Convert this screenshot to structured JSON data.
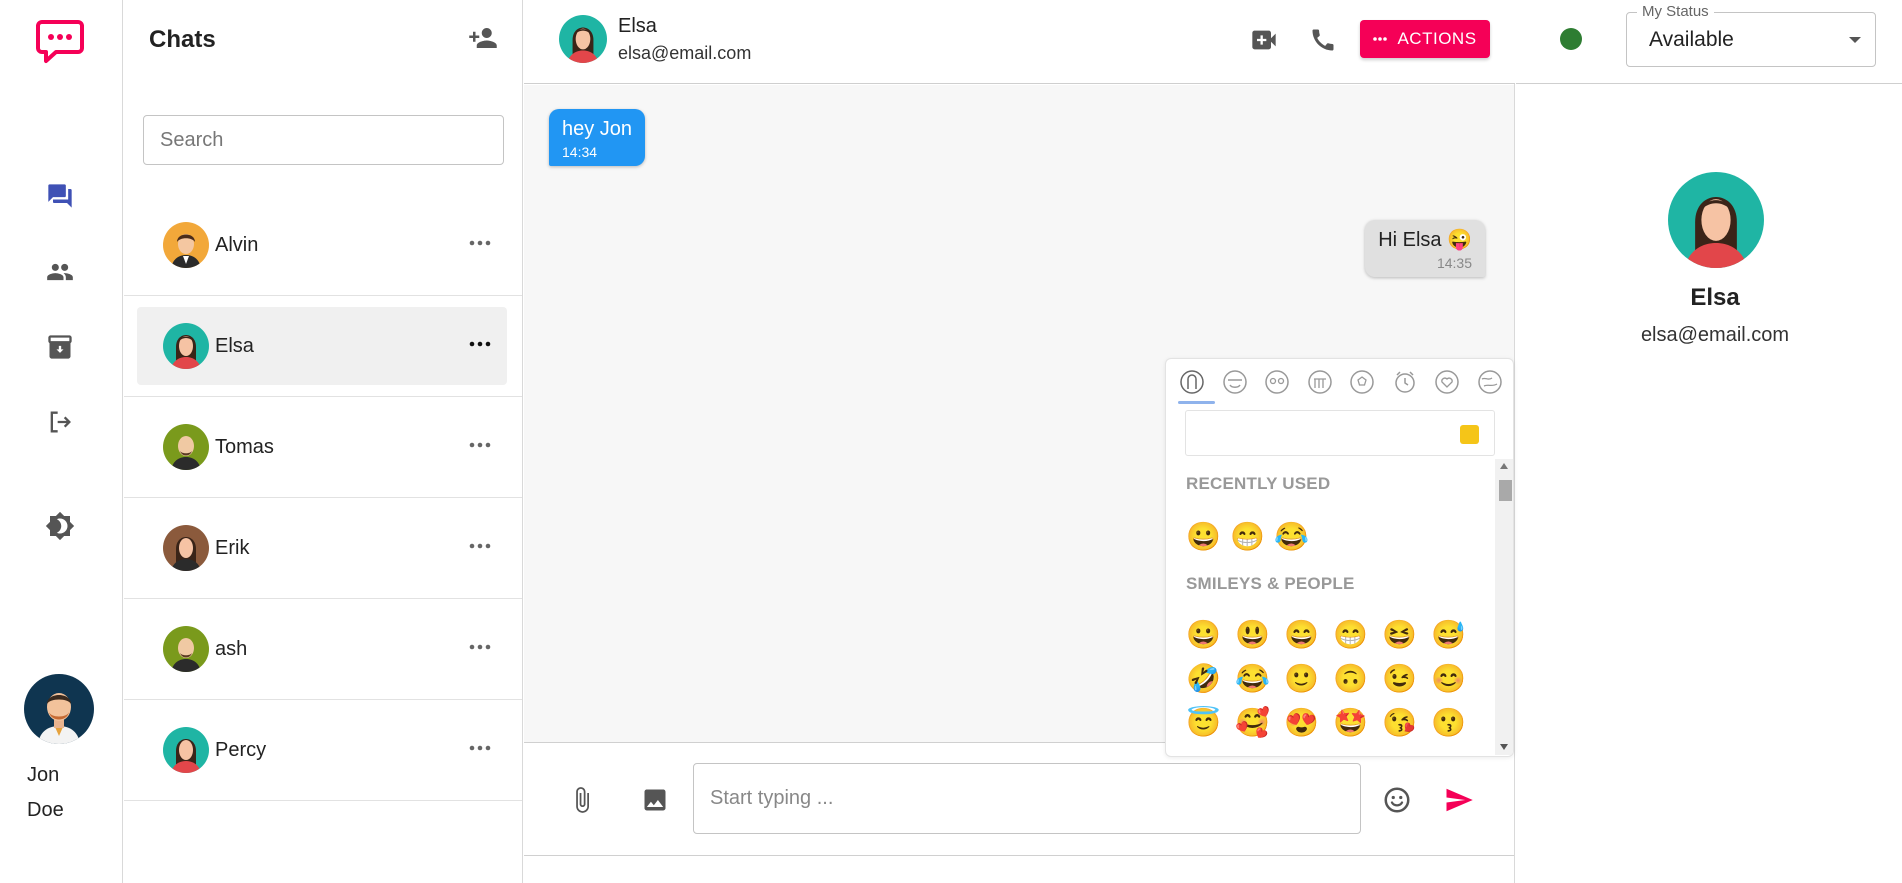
{
  "brand": {
    "accent": "#f50057",
    "primary": "#3f51b5",
    "incoming_bubble": "#2196f3"
  },
  "nav": {
    "items": [
      {
        "name": "chats-icon"
      },
      {
        "name": "contacts-icon"
      },
      {
        "name": "archive-icon"
      },
      {
        "name": "logout-icon"
      },
      {
        "name": "theme-toggle-icon"
      }
    ],
    "user": {
      "first": "Jon",
      "last": "Doe"
    }
  },
  "chats": {
    "title": "Chats",
    "search_placeholder": "Search",
    "contacts": [
      {
        "name": "Alvin",
        "avatar": "man-orange"
      },
      {
        "name": "Elsa",
        "avatar": "woman-teal",
        "active": true
      },
      {
        "name": "Tomas",
        "avatar": "man-green"
      },
      {
        "name": "Erik",
        "avatar": "woman-brown"
      },
      {
        "name": "ash",
        "avatar": "man-green"
      },
      {
        "name": "Percy",
        "avatar": "woman-teal"
      }
    ]
  },
  "conversation": {
    "contact_name": "Elsa",
    "contact_email": "elsa@email.com",
    "actions_label": "ACTIONS",
    "messages": [
      {
        "text": "hey Jon",
        "time": "14:34",
        "direction": "in"
      },
      {
        "text": "Hi Elsa 😜",
        "time": "14:35",
        "direction": "out"
      }
    ],
    "input_placeholder": "Start typing ..."
  },
  "emoji_picker": {
    "sections": [
      {
        "title": "RECENTLY USED",
        "rows": [
          [
            "😀",
            "😁",
            "😂"
          ]
        ]
      },
      {
        "title": "SMILEYS & PEOPLE",
        "rows": [
          [
            "😀",
            "😃",
            "😄",
            "😁",
            "😆",
            "😅"
          ],
          [
            "🤣",
            "😂",
            "🙂",
            "🙃",
            "😉",
            "😊"
          ],
          [
            "😇",
            "🥰",
            "😍",
            "🤩",
            "😘",
            "😗"
          ]
        ]
      }
    ]
  },
  "profile": {
    "status_label": "My Status",
    "status_value": "Available",
    "status_color": "#2e7d32",
    "name": "Elsa",
    "email": "elsa@email.com"
  }
}
